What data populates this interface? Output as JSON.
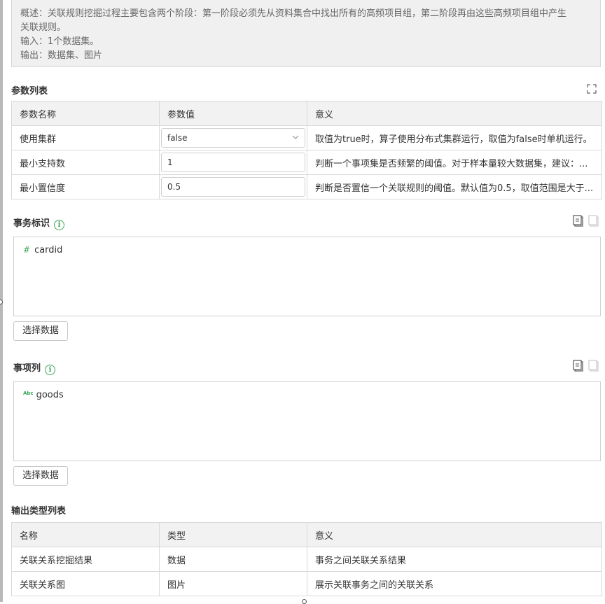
{
  "description": {
    "line1": "概述：关联规则挖掘过程主要包含两个阶段：第一阶段必须先从资料集合中找出所有的高频项目组，第二阶段再由这些高频项目组中产生",
    "line2": "关联规则。",
    "line3": "输入：1个数据集。",
    "line4": "输出：数据集、图片"
  },
  "params": {
    "title": "参数列表",
    "headers": [
      "参数名称",
      "参数值",
      "意义"
    ],
    "rows": [
      {
        "name": "使用集群",
        "value": "false",
        "meaning": "取值为true时，算子使用分布式集群运行，取值为false时单机运行。"
      },
      {
        "name": "最小支持数",
        "value": "1",
        "meaning": "判断一个事项集是否频繁的阈值。对于样本量较大数据集，建议：..."
      },
      {
        "name": "最小置信度",
        "value": "0.5",
        "meaning": "判断是否置信一个关联规则的阈值。默认值为0.5，取值范围是大于..."
      }
    ]
  },
  "transaction": {
    "title": "事务标识",
    "field": "cardid",
    "field_type_glyph": "#",
    "button": "选择数据"
  },
  "items": {
    "title": "事项列",
    "field": "goods",
    "field_type_glyph": "Abc",
    "button": "选择数据"
  },
  "outputs": {
    "title": "输出类型列表",
    "headers": [
      "名称",
      "类型",
      "意义"
    ],
    "rows": [
      {
        "name": "关联关系挖掘结果",
        "type": "数据",
        "meaning": "事务之间关联关系结果"
      },
      {
        "name": "关联关系图",
        "type": "图片",
        "meaning": "展示关联事务之间的关联关系"
      }
    ]
  },
  "icons": {
    "info": "info-circle-icon",
    "expand": "fullscreen-icon",
    "copy": "copy-icon",
    "paste": "paste-icon",
    "dropdown": "chevron-down-icon"
  },
  "colors": {
    "accent": "#3aa757",
    "header_bg": "#f2f2f2",
    "desc_bg": "#f0f0f0"
  }
}
